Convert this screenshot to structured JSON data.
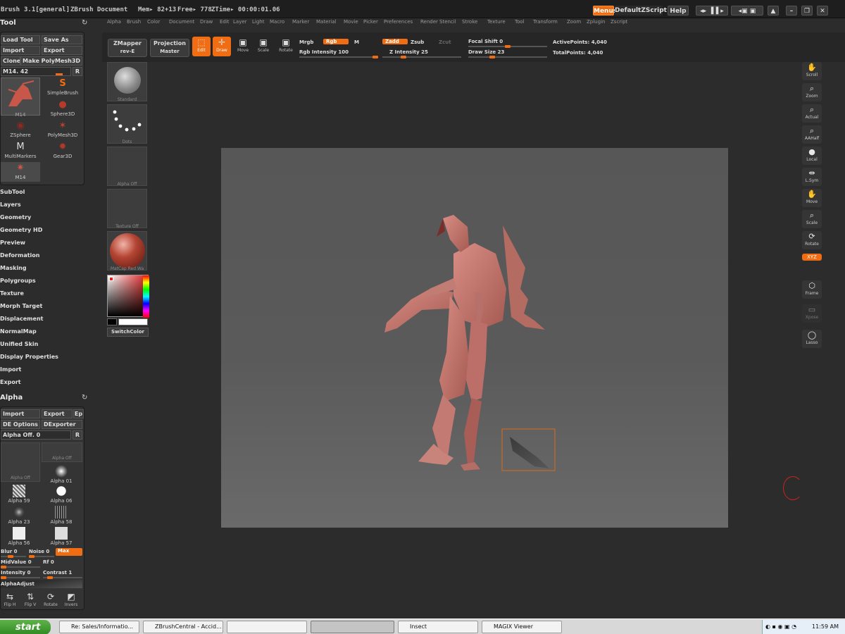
{
  "titlebar": {
    "app": "Brush",
    "version": "3.1[general]",
    "document": "ZBrush Document",
    "mem": "Mem▸ 82+13",
    "free": "Free▸ 778",
    "ztime": "ZTime▸ 00:00:01.06",
    "menus_btn": "Menus",
    "zscript_btn": "DefaultZScript",
    "help_btn": "Help"
  },
  "menubar": [
    "Alpha",
    "Brush",
    "Color",
    "Document",
    "Draw",
    "Edit",
    "Layer",
    "Light",
    "Macro",
    "Marker",
    "Material",
    "Movie",
    "Picker",
    "Preferences",
    "Render",
    "Stencil",
    "Stroke",
    "Texture",
    "Tool",
    "Transform",
    "Zoom",
    "Zplugin",
    "Zscript"
  ],
  "toolbar": {
    "zmapper": "ZMapper",
    "zmapper_sub": "rev-E",
    "projection": "Projection",
    "projection_sub": "Master",
    "edit": "Edit",
    "draw": "Draw",
    "move": "Move",
    "scale": "Scale",
    "rotate": "Rotate",
    "mrgb": "Mrgb",
    "rgb": "Rgb",
    "m": "M",
    "rgb_intensity": "Rgb  Intensity 100",
    "zadd": "Zadd",
    "zsub": "Zsub",
    "zcut": "Zcut",
    "z_intensity": "Z  Intensity 25",
    "focal_shift": "Focal Shift 0",
    "draw_size": "Draw  Size 23",
    "active_points": "ActivePoints: 4,040",
    "total_points": "TotalPoints: 4,040",
    "rgb_intensity_value": 100,
    "z_intensity_value": 25
  },
  "tool_panel": {
    "title": "Tool",
    "load_tool": "Load Tool",
    "save_as": "Save As",
    "import": "Import",
    "export": "Export",
    "clone": "Clone",
    "make_polymesh": "Make PolyMesh3D",
    "current": "M14. 42",
    "r": "R",
    "thumbs": [
      {
        "label": "M14",
        "icon": "insect-mesh-icon"
      },
      {
        "label": "SimpleBrush",
        "icon": "simplebrush-icon"
      },
      {
        "label": "Sphere3D",
        "icon": "sphere3d-icon"
      },
      {
        "label": "ZSphere",
        "icon": "zsphere-icon"
      },
      {
        "label": "PolyMesh3D",
        "icon": "polymesh3d-icon"
      },
      {
        "label": "MultiMarkers",
        "icon": "multimarkers-icon"
      },
      {
        "label": "Gear3D",
        "icon": "gear3d-icon"
      },
      {
        "label": "M14",
        "icon": "insect-mesh-small-icon"
      }
    ]
  },
  "palettes": [
    "SubTool",
    "Layers",
    "Geometry",
    "Geometry HD",
    "Preview",
    "Deformation",
    "Masking",
    "Polygroups",
    "Texture",
    "Morph Target",
    "Displacement",
    "NormalMap",
    "Unified Skin",
    "Display Properties",
    "Import",
    "Export"
  ],
  "alpha_panel": {
    "title": "Alpha",
    "import": "Import",
    "export": "Export",
    "ep": "Ep",
    "de_options": "DE Options",
    "dexporter": "DExporter",
    "alpha_off": "Alpha Off. 0",
    "r": "R",
    "cells": [
      "Alpha Off",
      "Alpha Off",
      "Alpha 01",
      "Alpha 59",
      "Alpha 06",
      "Alpha 23",
      "Alpha 58",
      "Alpha 56",
      "Alpha 57"
    ],
    "blur": "Blur 0",
    "noise": "Noise 0",
    "max": "Max",
    "midvalue": "MidValue 0",
    "rf": "Rf 0",
    "intensity": "Intensity 0",
    "contrast": "Contrast 1",
    "alphaadjust": "AlphaAdjust",
    "flip_h": "Flip H",
    "flip_v": "Flip V",
    "rotate": "Rotate",
    "invers": "Invers"
  },
  "brush_column": {
    "standard": "Standard",
    "dots": "Dots",
    "alpha_off": "Alpha  Off",
    "texture_off": "Texture  Off",
    "matcap": "MatCap  Red  Wa",
    "switch_color": "SwitchColor"
  },
  "right_shelf": [
    "Scroll",
    "Zoom",
    "Actual",
    "AAHalf",
    "Local",
    "L.Sym",
    "Move",
    "Scale",
    "Rotate",
    "XYZ",
    "Frame",
    "Xpose",
    "Lasso"
  ],
  "taskbar": {
    "start": "start",
    "items": [
      "Re: Sales/Informatio...",
      "ZBrushCentral - Accid...",
      "",
      "",
      "Insect",
      "MAGIX Viewer"
    ],
    "clock": "11:59 AM"
  },
  "colors": {
    "accent": "#f06d14",
    "background": "#2c2c2c",
    "model": "#c87870"
  }
}
